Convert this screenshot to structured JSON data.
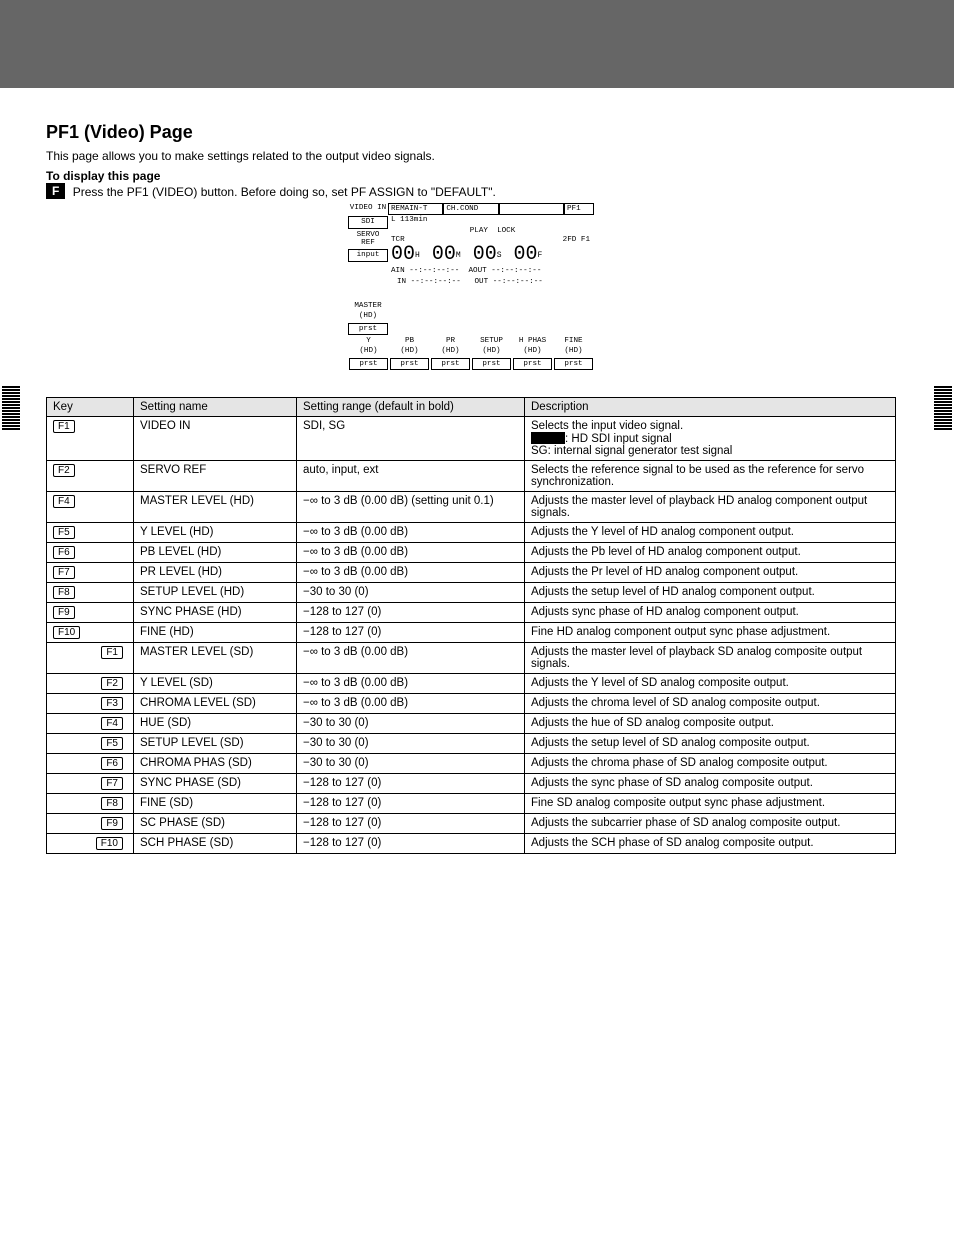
{
  "section_title": "PF1 (Video) Page",
  "subtitle": "This page allows you to make settings related to the output video signals.",
  "to_display_label": "To display this page",
  "to_display_text": "Press the PF1 (VIDEO) button. Before doing so, set PF ASSIGN to \"DEFAULT\".",
  "f_badge": "F",
  "panel": {
    "video_in": "VIDEO IN",
    "sdi": "SDI",
    "servo_ref": "SERVO REF",
    "input": "input",
    "remain": "REMAIN-T",
    "remain_val": "L 113min",
    "chcond": "CH.COND",
    "pf1": "PF1",
    "play": "PLAY",
    "lock": "LOCK",
    "tcr": "TCR",
    "field": "2FD F1",
    "tc_h": "00",
    "tc_m": "00",
    "tc_s": "00",
    "tc_f": "00",
    "ain": "AIN --:--:--:--",
    "aout": "AOUT --:--:--:--",
    "in": "IN --:--:--:--",
    "out": "OUT --:--:--:--",
    "master": "MASTER",
    "hd": "(HD)",
    "prst": "prst",
    "bottom": [
      {
        "l1": "Y",
        "l2": "(HD)"
      },
      {
        "l1": "PB",
        "l2": "(HD)"
      },
      {
        "l1": "PR",
        "l2": "(HD)"
      },
      {
        "l1": "SETUP",
        "l2": "(HD)"
      },
      {
        "l1": "H PHAS",
        "l2": "(HD)"
      },
      {
        "l1": "FINE",
        "l2": "(HD)"
      }
    ]
  },
  "table": {
    "headers": [
      "Key",
      "Setting name",
      "Setting range (default in bold)",
      "Description"
    ],
    "rows": [
      {
        "key": "F1",
        "name": "VIDEO IN",
        "range": "SDI, SG",
        "desc_html": "Selects the input video signal.<br><span class='blackbox'></span>: HD SDI input signal<br>SG: internal signal generator test signal"
      },
      {
        "key": "F2",
        "name": "SERVO REF",
        "range": "auto, input, ext",
        "desc_html": "Selects the reference signal to be used as the reference for servo synchronization."
      },
      {
        "key": "F4",
        "name": "MASTER LEVEL (HD)",
        "range": "−∞ to 3 dB (0.00 dB) (setting unit 0.1)",
        "desc_html": "Adjusts the master level of playback HD analog component output signals."
      },
      {
        "key": "F5",
        "name": "Y LEVEL (HD)",
        "range": "−∞ to 3 dB (0.00 dB)",
        "desc_html": "Adjusts the Y level of HD analog component output."
      },
      {
        "key": "F6",
        "name": "PB LEVEL (HD)",
        "range": "−∞ to 3 dB (0.00 dB)",
        "desc_html": "Adjusts the Pb level of HD analog component output."
      },
      {
        "key": "F7",
        "name": "PR LEVEL (HD)",
        "range": "−∞ to 3 dB (0.00 dB)",
        "desc_html": "Adjusts the Pr level of HD analog component output."
      },
      {
        "key": "F8",
        "name": "SETUP LEVEL (HD)",
        "range": "−30 to 30 (0)",
        "desc_html": "Adjusts the setup level of HD analog component output."
      },
      {
        "key": "F9",
        "name": "SYNC PHASE (HD)",
        "range": "−128 to 127 (0)",
        "desc_html": "Adjusts sync phase of HD analog component output."
      },
      {
        "key": "F10",
        "name": "FINE (HD)",
        "range": "−128 to 127 (0)",
        "desc_html": "Fine HD analog component output sync phase adjustment."
      },
      {
        "key": "F1",
        "nested": true,
        "name": "MASTER LEVEL (SD)",
        "range": "−∞ to 3 dB (0.00 dB)",
        "desc_html": "Adjusts the master level of playback SD analog composite output signals."
      },
      {
        "key": "F2",
        "nested": true,
        "name": "Y LEVEL (SD)",
        "range": "−∞ to 3 dB (0.00 dB)",
        "desc_html": "Adjusts the Y level of SD analog composite output."
      },
      {
        "key": "F3",
        "nested": true,
        "name": "CHROMA LEVEL (SD)",
        "range": "−∞ to 3 dB (0.00 dB)",
        "desc_html": "Adjusts the chroma level of SD analog composite output."
      },
      {
        "key": "F4",
        "nested": true,
        "name": "HUE (SD)",
        "range": "−30 to 30 (0)",
        "desc_html": "Adjusts the hue of SD analog composite output."
      },
      {
        "key": "F5",
        "nested": true,
        "name": "SETUP LEVEL (SD)",
        "range": "−30 to 30 (0)",
        "desc_html": "Adjusts the setup level of SD analog composite output."
      },
      {
        "key": "F6",
        "nested": true,
        "name": "CHROMA PHAS (SD)",
        "range": "−30 to 30 (0)",
        "desc_html": "Adjusts the chroma phase of SD analog composite output."
      },
      {
        "key": "F7",
        "nested": true,
        "name": "SYNC PHASE (SD)",
        "range": "−128 to 127 (0)",
        "desc_html": "Adjusts the sync phase of SD analog composite output."
      },
      {
        "key": "F8",
        "nested": true,
        "name": "FINE (SD)",
        "range": "−128 to 127 (0)",
        "desc_html": "Fine SD analog composite output sync phase adjustment."
      },
      {
        "key": "F9",
        "nested": true,
        "name": "SC PHASE (SD)",
        "range": "−128 to 127 (0)",
        "desc_html": "Adjusts the subcarrier phase of SD analog composite output."
      },
      {
        "key": "F10",
        "nested": true,
        "name": "SCH PHASE (SD)",
        "range": "−128 to 127 (0)",
        "desc_html": "Adjusts the SCH phase of SD analog composite output."
      }
    ]
  }
}
